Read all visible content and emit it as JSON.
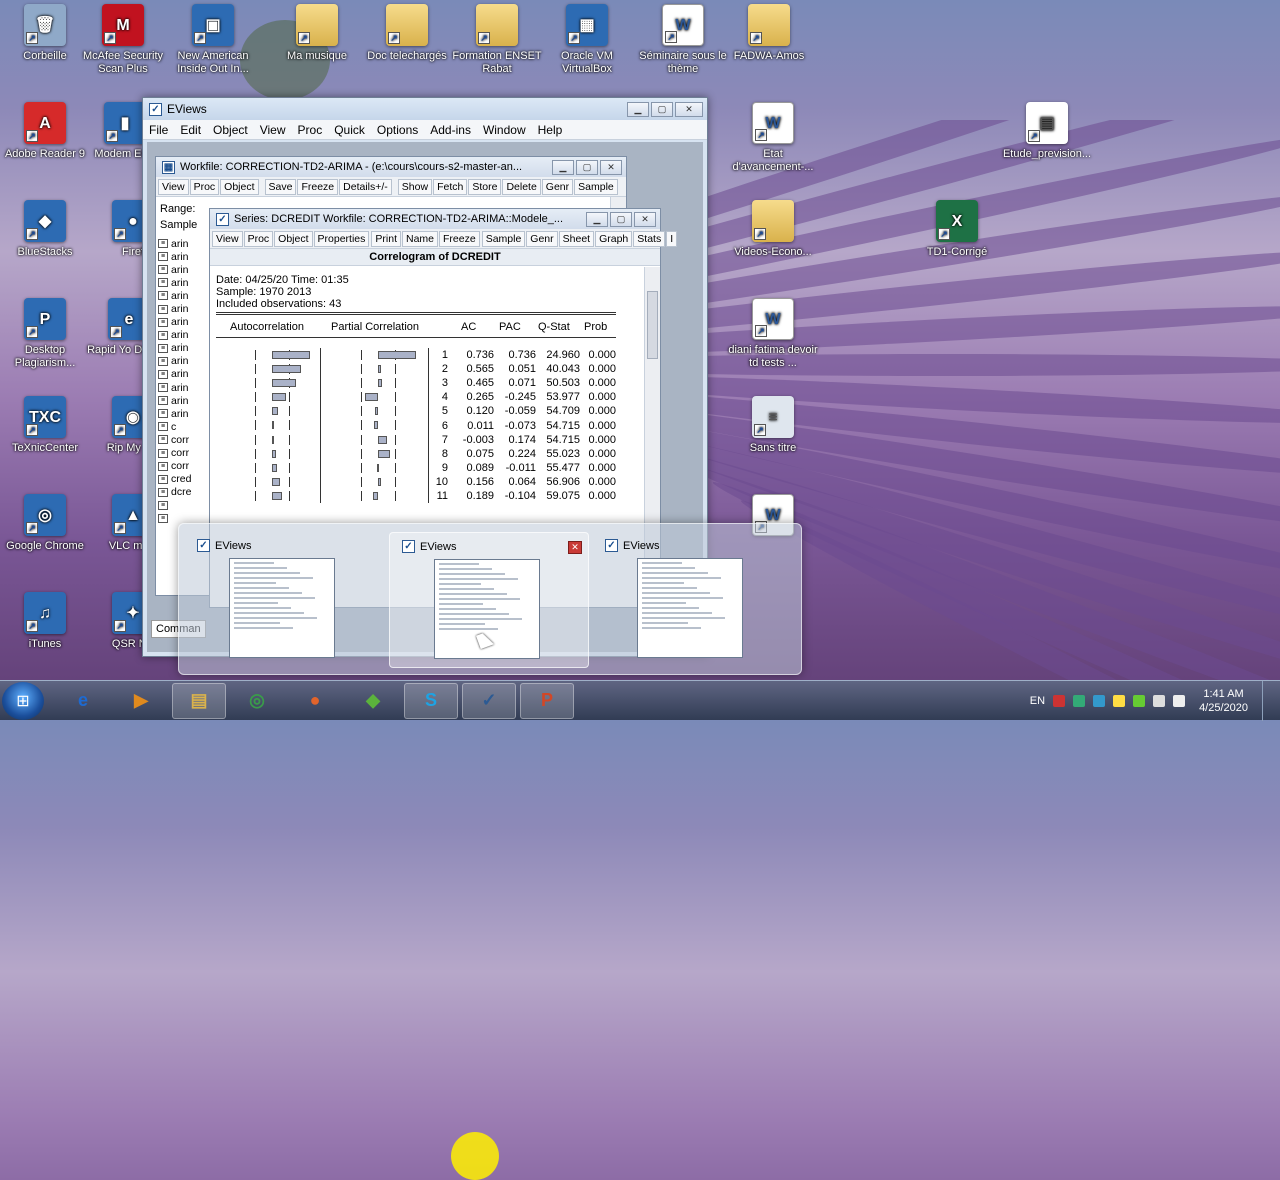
{
  "desktop": {
    "icons": [
      {
        "label": "Corbeille",
        "glyph": "🗑",
        "kind": "bin"
      },
      {
        "label": "McAfee Security Scan Plus",
        "glyph": "M",
        "kind": "mcafee"
      },
      {
        "label": "New American Inside Out In...",
        "glyph": "▣",
        "kind": "app"
      },
      {
        "label": "Ma musique",
        "glyph": "",
        "kind": "folder"
      },
      {
        "label": "Doc telechargés",
        "glyph": "",
        "kind": "folder"
      },
      {
        "label": "Formation ENSET Rabat",
        "glyph": "",
        "kind": "folder"
      },
      {
        "label": "Oracle VM VirtualBox",
        "glyph": "▦",
        "kind": "app"
      },
      {
        "label": "Séminaire sous le thème",
        "glyph": "W",
        "kind": "word"
      },
      {
        "label": "FADWA-Amos",
        "glyph": "",
        "kind": "folder"
      },
      {
        "label": "Adobe Reader 9",
        "glyph": "A",
        "kind": "pdf"
      },
      {
        "label": "Modem EC1",
        "glyph": "▮",
        "kind": "app"
      },
      {
        "label": "BlueStacks",
        "glyph": "◆",
        "kind": "app"
      },
      {
        "label": "Firef",
        "glyph": "●",
        "kind": "app"
      },
      {
        "label": "Desktop Plagiarism...",
        "glyph": "P",
        "kind": "app"
      },
      {
        "label": "Rapid Yo Downlo",
        "glyph": "e",
        "kind": "app"
      },
      {
        "label": "TeXnicCenter",
        "glyph": "TXC",
        "kind": "app"
      },
      {
        "label": "Rip My 1.2",
        "glyph": "◉",
        "kind": "app"
      },
      {
        "label": "Google Chrome",
        "glyph": "◎",
        "kind": "app"
      },
      {
        "label": "VLC medi",
        "glyph": "▲",
        "kind": "app"
      },
      {
        "label": "iTunes",
        "glyph": "♫",
        "kind": "app"
      },
      {
        "label": "QSR NV",
        "glyph": "✦",
        "kind": "app"
      },
      {
        "label": "Etat d'avancement-...",
        "glyph": "W",
        "kind": "word"
      },
      {
        "label": "Etude_prevision...",
        "glyph": "▤",
        "kind": "pdfdoc"
      },
      {
        "label": "Videos-Econo...",
        "glyph": "",
        "kind": "folder"
      },
      {
        "label": "TD1-Corrigé",
        "glyph": "X",
        "kind": "excel"
      },
      {
        "label": "diani fatima devoir td tests ...",
        "glyph": "W",
        "kind": "word"
      },
      {
        "label": "Sans titre",
        "glyph": "≡",
        "kind": "doc"
      },
      {
        "label": "",
        "glyph": "W",
        "kind": "word"
      }
    ]
  },
  "eviews": {
    "title": "EViews",
    "menu": [
      "File",
      "Edit",
      "Object",
      "View",
      "Proc",
      "Quick",
      "Options",
      "Add-ins",
      "Window",
      "Help"
    ],
    "workfile": {
      "title": "Workfile: CORRECTION-TD2-ARIMA - (e:\\cours\\cours-s2-master-an...",
      "toolbar": [
        "View",
        "Proc",
        "Object",
        "Save",
        "Freeze",
        "Details+/-",
        "Show",
        "Fetch",
        "Store",
        "Delete",
        "Genr",
        "Sample"
      ],
      "range_label": "Range:",
      "sample_label": "Sample",
      "items": [
        "arin",
        "arin",
        "arin",
        "arin",
        "arin",
        "arin",
        "arin",
        "arin",
        "arin",
        "arin",
        "arin",
        "arin",
        "arin",
        "arin",
        "c",
        "corr",
        "corr",
        "corr",
        "cred",
        "dcre",
        "",
        ""
      ]
    },
    "series": {
      "title": "Series: DCREDIT   Workfile: CORRECTION-TD2-ARIMA::Modele_...",
      "toolbar": [
        "View",
        "Proc",
        "Object",
        "Properties",
        "Print",
        "Name",
        "Freeze",
        "Sample",
        "Genr",
        "Sheet",
        "Graph",
        "Stats",
        "I"
      ],
      "heading": "Correlogram of DCREDIT",
      "date_line": "Date: 04/25/20   Time: 01:35",
      "sample_line": "Sample: 1970 2013",
      "obs_line": "Included observations: 43",
      "columns": {
        "ac_graph": "Autocorrelation",
        "pac_graph": "Partial Correlation",
        "ac": "AC",
        "pac": "PAC",
        "q": "Q-Stat",
        "prob": "Prob"
      },
      "rows": [
        {
          "lag": "1",
          "ac": "0.736",
          "pac": "0.736",
          "q": "24.960",
          "prob": "0.000",
          "ac_val": 0.736,
          "pac_val": 0.736
        },
        {
          "lag": "2",
          "ac": "0.565",
          "pac": "0.051",
          "q": "40.043",
          "prob": "0.000",
          "ac_val": 0.565,
          "pac_val": 0.051
        },
        {
          "lag": "3",
          "ac": "0.465",
          "pac": "0.071",
          "q": "50.503",
          "prob": "0.000",
          "ac_val": 0.465,
          "pac_val": 0.071
        },
        {
          "lag": "4",
          "ac": "0.265",
          "pac": "-0.245",
          "q": "53.977",
          "prob": "0.000",
          "ac_val": 0.265,
          "pac_val": -0.245
        },
        {
          "lag": "5",
          "ac": "0.120",
          "pac": "-0.059",
          "q": "54.709",
          "prob": "0.000",
          "ac_val": 0.12,
          "pac_val": -0.059
        },
        {
          "lag": "6",
          "ac": "0.011",
          "pac": "-0.073",
          "q": "54.715",
          "prob": "0.000",
          "ac_val": 0.011,
          "pac_val": -0.073
        },
        {
          "lag": "7",
          "ac": "-0.003",
          "pac": "0.174",
          "q": "54.715",
          "prob": "0.000",
          "ac_val": -0.003,
          "pac_val": 0.174
        },
        {
          "lag": "8",
          "ac": "0.075",
          "pac": "0.224",
          "q": "55.023",
          "prob": "0.000",
          "ac_val": 0.075,
          "pac_val": 0.224
        },
        {
          "lag": "9",
          "ac": "0.089",
          "pac": "-0.011",
          "q": "55.477",
          "prob": "0.000",
          "ac_val": 0.089,
          "pac_val": -0.011
        },
        {
          "lag": "10",
          "ac": "0.156",
          "pac": "0.064",
          "q": "56.906",
          "prob": "0.000",
          "ac_val": 0.156,
          "pac_val": 0.064
        },
        {
          "lag": "11",
          "ac": "0.189",
          "pac": "-0.104",
          "q": "59.075",
          "prob": "0.000",
          "ac_val": 0.189,
          "pac_val": -0.104
        }
      ]
    },
    "command_label": "Comman"
  },
  "thumbnails": [
    {
      "title": "EViews",
      "active": false
    },
    {
      "title": "EViews",
      "active": true
    },
    {
      "title": "EViews",
      "active": false
    }
  ],
  "taskbar": {
    "apps": [
      "ie",
      "media",
      "explorer",
      "chrome",
      "firefox",
      "bluestacks",
      "skype",
      "eviews",
      "powerpoint"
    ],
    "language": "EN",
    "time": "1:41 AM",
    "date": "4/25/2020"
  }
}
